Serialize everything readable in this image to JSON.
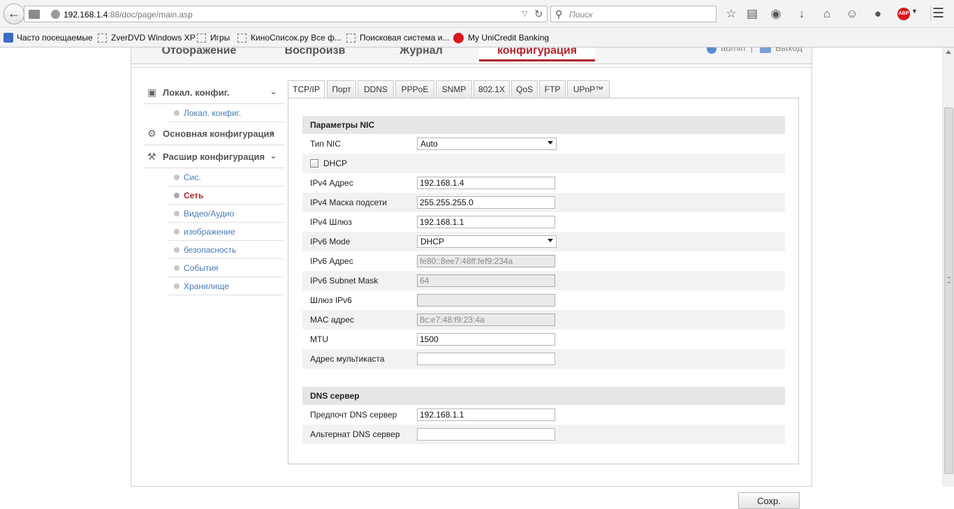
{
  "browser": {
    "url_host": "192.168.1.4",
    "url_rest": ":88/doc/page/main.asp",
    "search_placeholder": "Поиск"
  },
  "bookmarks": [
    "Часто посещаемые",
    "ZverDVD Windows XP",
    "Игры",
    "КиноСписок.ру Все ф...",
    "Поисковая система и...",
    "My UniCredit Banking"
  ],
  "topnav": {
    "tabs": [
      "Отображение",
      "Воспроизв",
      "Журнал",
      "конфигурация"
    ],
    "active_tab": "конфигурация",
    "user": "admin",
    "separator": "|",
    "logout": "Выход"
  },
  "sidebar": {
    "local_section": "Локал. конфиг.",
    "local_items": [
      "Локал. конфиг."
    ],
    "basic_section": "Основная конфигурация",
    "advanced_section": "Расшир конфигурация",
    "advanced_items": [
      "Сис.",
      "Сеть",
      "Видео/Аудио",
      "изображение",
      "безопасность",
      "События",
      "Хранилище"
    ],
    "active_item": "Сеть"
  },
  "tabs": [
    "TCP/IP",
    "Порт",
    "DDNS",
    "PPPoE",
    "SNMP",
    "802.1X",
    "QoS",
    "FTP",
    "UPnP™"
  ],
  "active_tab": "TCP/IP",
  "nic": {
    "header": "Параметры NIC",
    "nic_type_label": "Тип NIC",
    "nic_type_value": "Auto",
    "dhcp_label": "DHCP",
    "dhcp_checked": false,
    "ipv4_addr_label": "IPv4 Адрес",
    "ipv4_addr": "192.168.1.4",
    "ipv4_mask_label": "IPv4 Маска подсети",
    "ipv4_mask": "255.255.255.0",
    "ipv4_gw_label": "IPv4 Шлюз",
    "ipv4_gw": "192.168.1.1",
    "ipv6_mode_label": "IPv6 Mode",
    "ipv6_mode": "DHCP",
    "ipv6_addr_label": "IPv6 Адрес",
    "ipv6_addr": "fe80::8ee7:48ff:fef9:234a",
    "ipv6_mask_label": "IPv6 Subnet Mask",
    "ipv6_mask": "64",
    "ipv6_gw_label": "Шлюз IPv6",
    "ipv6_gw": "",
    "mac_label": "MAC адрес",
    "mac": "8c:e7:48:f9:23:4a",
    "mtu_label": "MTU",
    "mtu": "1500",
    "multicast_label": "Адрес мультикаста",
    "multicast": ""
  },
  "dns": {
    "header": "DNS сервер",
    "preferred_label": "Предпочт DNS сервер",
    "preferred": "192.168.1.1",
    "alternate_label": "Альтернат DNS сервер",
    "alternate": ""
  },
  "save_label": "Сохр."
}
